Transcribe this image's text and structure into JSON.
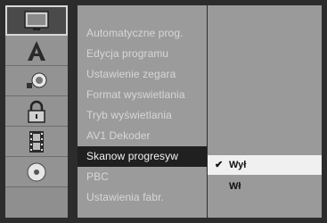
{
  "tabs": [
    {
      "id": "display",
      "icon": "monitor-icon",
      "active": true
    },
    {
      "id": "language",
      "icon": "letter-a-icon",
      "active": false
    },
    {
      "id": "audio",
      "icon": "speaker-icon",
      "active": false
    },
    {
      "id": "lock",
      "icon": "padlock-icon",
      "active": false
    },
    {
      "id": "recording",
      "icon": "film-strip-icon",
      "active": false
    },
    {
      "id": "disc",
      "icon": "disc-icon",
      "active": false
    }
  ],
  "menu": {
    "items": [
      "Automatyczne prog.",
      "Edycja programu",
      "Ustawienie zegara",
      "Format wyswietlania",
      "Tryb wyświetlania",
      "AV1 Dekoder",
      "Skanow progresyw",
      "PBC",
      "Ustawienia fabr."
    ],
    "selected_index": 6
  },
  "options": {
    "items": [
      "Wył",
      "Wł"
    ],
    "selected_index": 0,
    "check_mark": "✔"
  },
  "colors": {
    "background": "#2c2c2c",
    "panel": "#9b9b9b",
    "selected_item": "#202020",
    "highlight_option": "#f0f0f0"
  }
}
